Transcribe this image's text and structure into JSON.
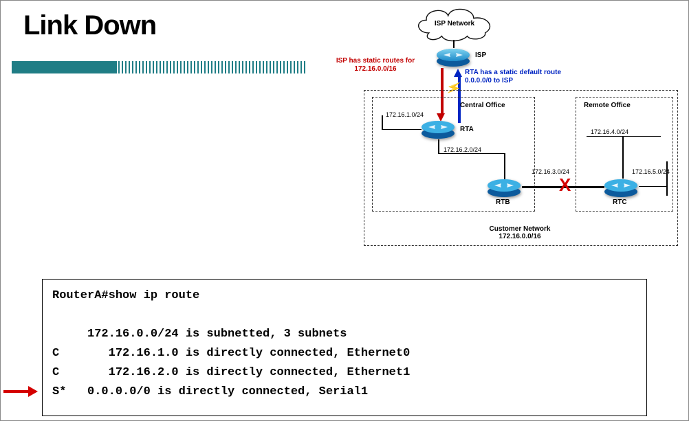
{
  "title": "Link Down",
  "notes": {
    "isp_static": "ISP has static routes for\n172.16.0.0/16",
    "rta_default": "RTA has a static default\nroute 0.0.0.0/0 to ISP"
  },
  "cloud": {
    "label": "ISP Network"
  },
  "routers": {
    "isp": {
      "label": "ISP"
    },
    "rta": {
      "label": "RTA"
    },
    "rtb": {
      "label": "RTB"
    },
    "rtc": {
      "label": "RTC"
    }
  },
  "boxes": {
    "central": {
      "label": "Central Office"
    },
    "remote": {
      "label": "Remote Office"
    },
    "customer_title": "Customer Network",
    "customer_subnet": "172.16.0.0/16"
  },
  "subnets": {
    "rta_e0": "172.16.1.0/24",
    "rta_e1": "172.16.2.0/24",
    "rtb_rtc": "172.16.3.0/24",
    "rtc_e0": "172.16.4.0/24",
    "rtc_e1": "172.16.5.0/24"
  },
  "cli": {
    "prompt": "RouterA#show ip route",
    "summary": "     172.16.0.0/24 is subnetted, 3 subnets",
    "r1": "C       172.16.1.0 is directly connected, Ethernet0",
    "r2": "C       172.16.2.0 is directly connected, Ethernet1",
    "r3": "S*   0.0.0.0/0 is directly connected, Serial1"
  }
}
